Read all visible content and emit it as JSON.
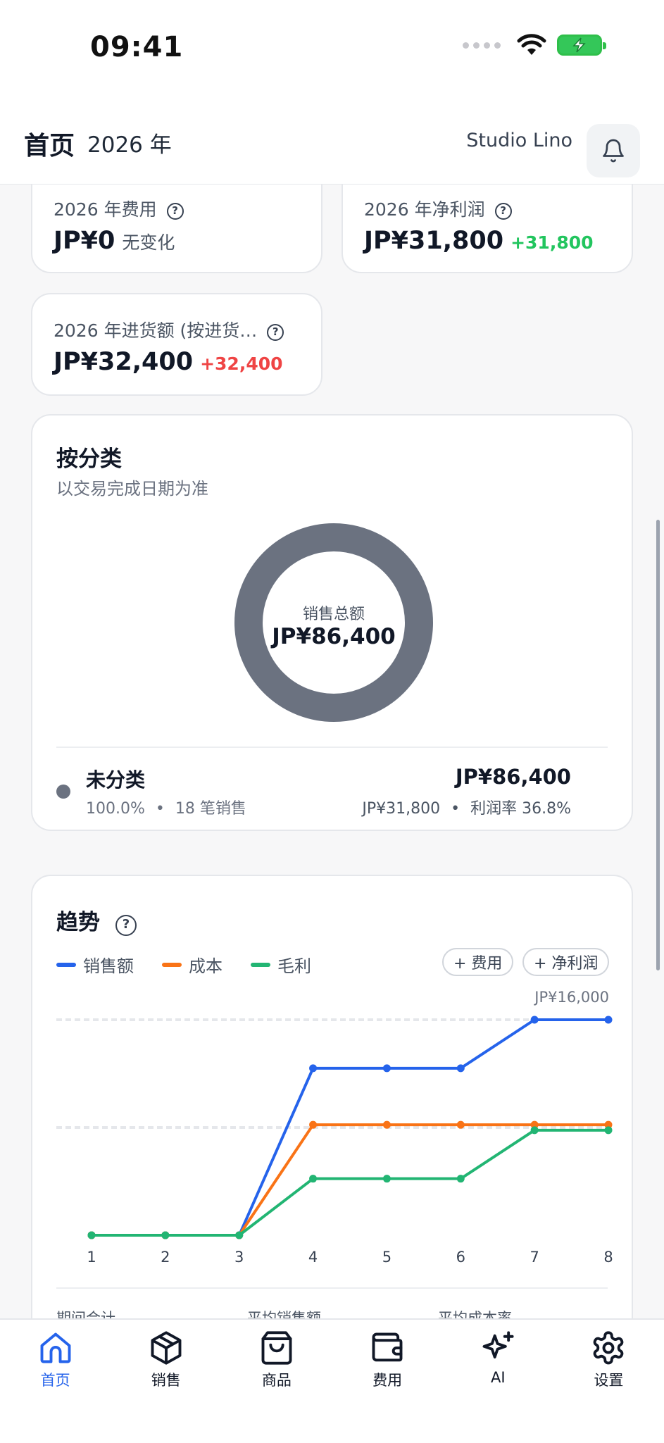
{
  "status": {
    "time": "09:41"
  },
  "header": {
    "title": "首页",
    "year": "2026 年",
    "store": "Studio Lino"
  },
  "stats": [
    {
      "label": "2026 年费用",
      "value": "JP¥0",
      "delta": "无变化",
      "delta_color": "#4b5563"
    },
    {
      "label": "2026 年净利润",
      "value": "JP¥31,800",
      "delta": "+31,800",
      "delta_color": "#22c55e"
    },
    {
      "label": "2026 年进货额 (按进货…",
      "value": "JP¥32,400",
      "delta": "+32,400",
      "delta_color": "#ef4444"
    }
  ],
  "category": {
    "title": "按分类",
    "subtitle": "以交易完成日期为准",
    "donut_label": "销售总额",
    "donut_value": "JP¥86,400",
    "donut_color": "#6b7280",
    "row": {
      "name": "未分类",
      "share": "100.0%",
      "separator": "•",
      "count": "18 笔销售",
      "amount": "JP¥86,400",
      "profit": "JP¥31,800",
      "margin": "利润率 36.8%"
    }
  },
  "trend": {
    "title": "趋势",
    "chips": [
      "+ 费用",
      "+ 净利润"
    ],
    "top_label": "JP¥16,000",
    "summary": [
      "期间合计",
      "平均销售额",
      "平均成本率"
    ]
  },
  "chart_data": {
    "type": "line",
    "x": [
      1,
      2,
      3,
      4,
      5,
      6,
      7,
      8
    ],
    "series": [
      {
        "name": "销售额",
        "color": "#2563eb",
        "values": [
          0,
          0,
          0,
          12400,
          12400,
          12400,
          16000,
          16000
        ]
      },
      {
        "name": "成本",
        "color": "#f97316",
        "values": [
          0,
          0,
          0,
          8200,
          8200,
          8200,
          8200,
          8200
        ]
      },
      {
        "name": "毛利",
        "color": "#22b573",
        "values": [
          0,
          0,
          0,
          4200,
          4200,
          4200,
          7800,
          7800
        ]
      }
    ],
    "ylim": [
      0,
      16000
    ],
    "grid": true
  },
  "tabs": [
    {
      "label": "首页",
      "icon": "home-icon",
      "active": true
    },
    {
      "label": "销售",
      "icon": "package-icon",
      "active": false
    },
    {
      "label": "商品",
      "icon": "shopping-bag-icon",
      "active": false
    },
    {
      "label": "费用",
      "icon": "wallet-icon",
      "active": false
    },
    {
      "label": "AI",
      "icon": "sparkles-icon",
      "active": false
    },
    {
      "label": "设置",
      "icon": "gear-icon",
      "active": false
    }
  ],
  "colors": {
    "accent": "#2563eb",
    "positive": "#22c55e",
    "negative": "#ef4444"
  }
}
